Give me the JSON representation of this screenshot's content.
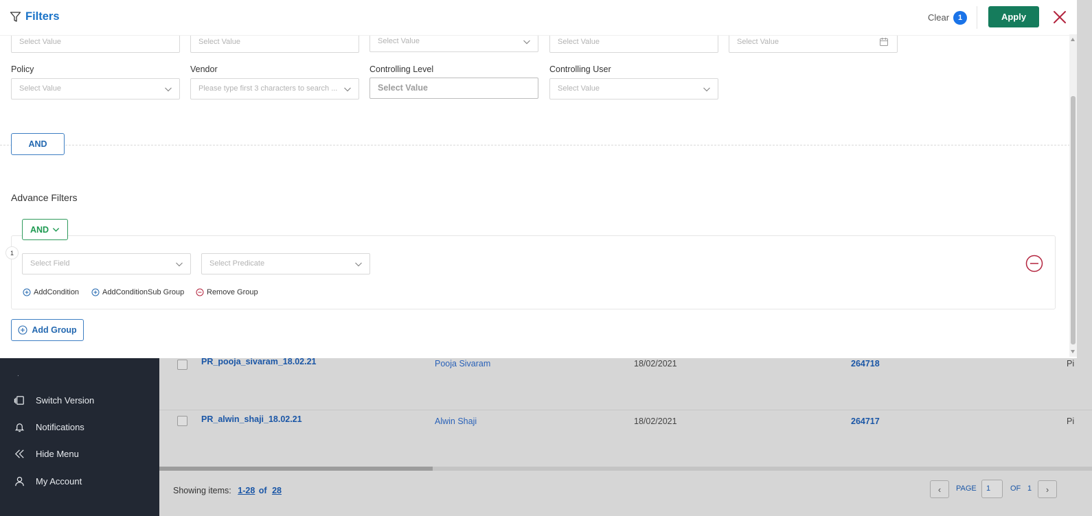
{
  "header": {
    "title": "Filters",
    "clear_label": "Clear",
    "clear_count": "1",
    "apply_label": "Apply"
  },
  "top_row_fields": [
    {
      "placeholder": "Select Value"
    },
    {
      "placeholder": "Select Value"
    },
    {
      "placeholder": "Select Value"
    },
    {
      "placeholder": "Select Value"
    },
    {
      "placeholder": "Select Value"
    }
  ],
  "filters": [
    {
      "label": "Policy",
      "placeholder": "Select Value"
    },
    {
      "label": "Vendor",
      "placeholder": "Please type first 3 characters to search ..."
    },
    {
      "label": "Controlling Level",
      "placeholder": "Select Value"
    },
    {
      "label": "Controlling User",
      "placeholder": "Select Value"
    }
  ],
  "and_button": "AND",
  "advance": {
    "title": "Advance Filters",
    "operator": "AND",
    "group_number": "1",
    "select_field": "Select Field",
    "select_predicate": "Select Predicate",
    "actions": {
      "add_condition": "AddCondition",
      "add_sub_group": "AddConditionSub Group",
      "remove_group": "Remove Group"
    },
    "add_group": "Add Group"
  },
  "sidebar": {
    "dot": ".",
    "items": [
      {
        "label": "Switch Version",
        "icon": "switch-version-icon"
      },
      {
        "label": "Notifications",
        "icon": "bell-icon"
      },
      {
        "label": "Hide Menu",
        "icon": "double-chevron-left-icon"
      },
      {
        "label": "My Account",
        "icon": "user-icon"
      }
    ]
  },
  "table": {
    "rows": [
      {
        "name": "PR_pooja_sivaram_18.02.21",
        "user": "Pooja Sivaram",
        "date": "18/02/2021",
        "id": "264718",
        "cut": "Pi"
      },
      {
        "name": "PR_alwin_shaji_18.02.21",
        "user": "Alwin Shaji",
        "date": "18/02/2021",
        "id": "264717",
        "cut": "Pi"
      }
    ]
  },
  "footer": {
    "showing_label": "Showing items:",
    "range": "1-28",
    "of": "of",
    "total": "28",
    "page_label": "PAGE",
    "page_value": "1",
    "of_label": "OF",
    "total_pages": "1"
  },
  "colors": {
    "primary_blue": "#1a73c8",
    "apply_green": "#157c5c",
    "and_green": "#1f9a52",
    "remove_red": "#b3243e",
    "sidebar_bg": "#222833"
  }
}
